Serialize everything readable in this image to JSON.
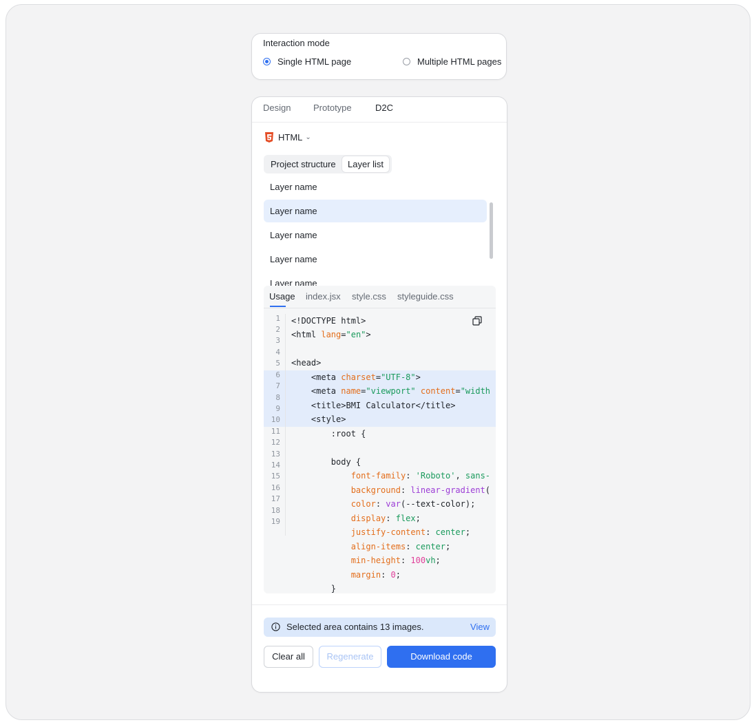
{
  "interaction": {
    "title": "Interaction mode",
    "options": [
      {
        "label": "Single HTML page",
        "selected": true
      },
      {
        "label": "Multiple HTML pages",
        "selected": false
      }
    ]
  },
  "tabs": [
    "Design",
    "Prototype",
    "D2C"
  ],
  "active_tab": "D2C",
  "language": {
    "label": "HTML",
    "icon": "html5-icon"
  },
  "segmented": {
    "options": [
      "Project structure",
      "Layer list"
    ],
    "active": "Layer list"
  },
  "layers": [
    "Layer name",
    "Layer name",
    "Layer name",
    "Layer name",
    "Layer name"
  ],
  "selected_layer_index": 1,
  "code_tabs": [
    "Usage",
    "index.jsx",
    "style.css",
    "styleguide.css"
  ],
  "active_code_tab": "Usage",
  "line_numbers": [
    "1",
    "2",
    "3",
    "4",
    "5",
    "6",
    "7",
    "8",
    "9",
    "10",
    "11",
    "12",
    "13",
    "14",
    "15",
    "16",
    "17",
    "18",
    "19"
  ],
  "code": {
    "l1": "<!DOCTYPE html>",
    "l2a": "<html ",
    "l2b": "lang",
    "l2c": "=",
    "l2d": "\"en\"",
    "l2e": ">",
    "l3": "<head>",
    "l4a": "    <meta ",
    "l4b": "charset",
    "l4c": "=",
    "l4d": "\"UTF-8\"",
    "l4e": ">",
    "l5a": "    <meta ",
    "l5b": "name",
    "l5c": "=",
    "l5d": "\"viewport\"",
    "l5e": " ",
    "l5f": "content",
    "l5g": "=",
    "l5h": "\"width",
    "l6": "    <title>BMI Calculator</title>",
    "l7": "    <style>",
    "l8": "        :root {",
    "l9": "        body {",
    "l10a": "            ",
    "l10b": "font-family",
    "l10c": ": ",
    "l10d": "'Roboto'",
    "l10e": ", ",
    "l10f": "sans-",
    "l11a": "            ",
    "l11b": "background",
    "l11c": ": ",
    "l11d": "linear-gradient",
    "l11e": "(",
    "l12a": "            ",
    "l12b": "color",
    "l12c": ": ",
    "l12d": "var",
    "l12e": "(--text-color);",
    "l13a": "            ",
    "l13b": "display",
    "l13c": ": ",
    "l13d": "flex",
    "l13e": ";",
    "l14a": "            ",
    "l14b": "justify-content",
    "l14c": ": ",
    "l14d": "center",
    "l14e": ";",
    "l15a": "            ",
    "l15b": "align-items",
    "l15c": ": ",
    "l15d": "center",
    "l15e": ";",
    "l16a": "            ",
    "l16b": "min-height",
    "l16c": ": ",
    "l16d": "100",
    "l16e": "vh",
    "l16f": ";",
    "l17a": "            ",
    "l17b": "margin",
    "l17c": ": ",
    "l17d": "0",
    "l17e": ";",
    "l18": "        }"
  },
  "notice": {
    "message": "Selected area contains 13 images.",
    "action": "View"
  },
  "buttons": {
    "clear": "Clear all",
    "regenerate": "Regenerate",
    "download": "Download code"
  },
  "colors": {
    "accent": "#2f6ff0",
    "selected_row": "#e6effd",
    "notice_bg": "#dbe8fb",
    "html5": "#e44d26"
  }
}
